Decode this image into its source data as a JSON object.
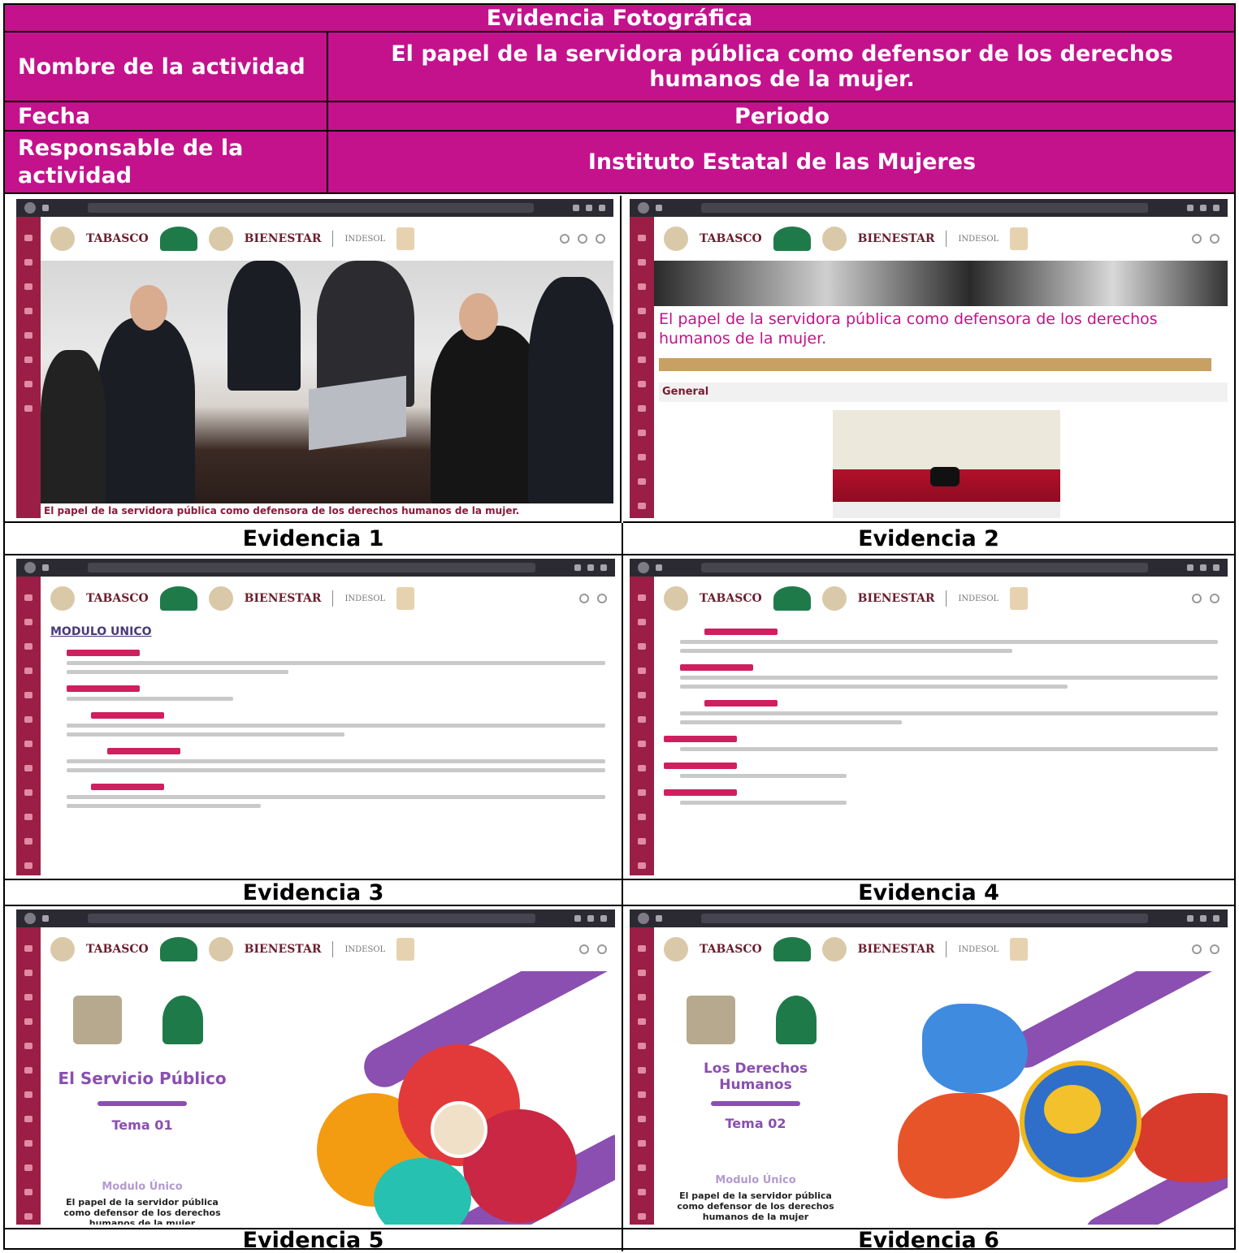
{
  "header": {
    "title": "Evidencia Fotográfica",
    "activity_label": "Nombre de la actividad",
    "activity_value": "El papel de la servidora pública como defensor de los derechos humanos de la mujer.",
    "date_label": "Fecha",
    "date_value": "Periodo",
    "responsible_label": "Responsable de la actividad",
    "responsible_value": "Instituto Estatal de las Mujeres"
  },
  "site": {
    "state": "TABASCO",
    "brand": "BIENESTAR",
    "agency": "INDESOL"
  },
  "evidences": [
    {
      "caption": "Evidencia 1",
      "photo_caption": "El papel de la servidora pública como defensora de los derechos humanos de la mujer."
    },
    {
      "caption": "Evidencia 2",
      "course_title": "El papel de la servidora pública como defensora de los derechos humanos de la mujer.",
      "section": "General"
    },
    {
      "caption": "Evidencia 3",
      "heading": "MODULO UNICO"
    },
    {
      "caption": "Evidencia 4"
    },
    {
      "caption": "Evidencia 5",
      "slide_title": "El Servicio Público",
      "topic": "Tema 01",
      "module": "Modulo Único",
      "description": "El papel de la servidor pública como defensor de los derechos humanos de la mujer"
    },
    {
      "caption": "Evidencia 6",
      "slide_title": "Los Derechos Humanos",
      "topic": "Tema 02",
      "module": "Modulo Único",
      "description": "El papel de la servidor pública como defensor de los derechos humanos de la mujer"
    }
  ],
  "colors": {
    "header_bg": "#c3128c",
    "sidebar": "#9a1e45",
    "accent": "#8a4fb0"
  }
}
